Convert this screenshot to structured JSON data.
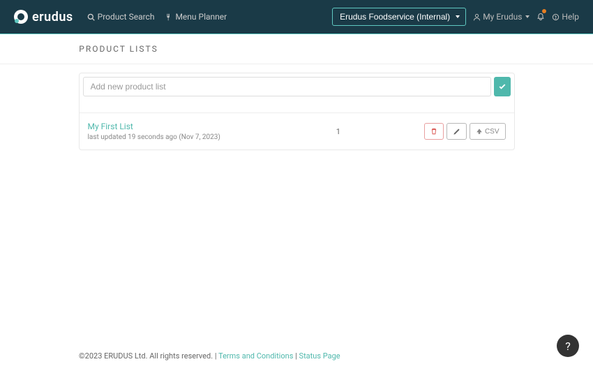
{
  "brand": "erudus",
  "nav": {
    "productSearch": "Product Search",
    "menuPlanner": "Menu Planner",
    "organization": "Erudus Foodservice (Internal)",
    "myErudus": "My Erudus",
    "help": "Help"
  },
  "page": {
    "title": "PRODUCT LISTS"
  },
  "input": {
    "placeholder": "Add new product list"
  },
  "lists": [
    {
      "name": "My First List",
      "meta": "last updated 19 seconds ago (Nov 7, 2023)",
      "count": "1"
    }
  ],
  "actions": {
    "csv": "CSV"
  },
  "footer": {
    "copyright": "©2023 ERUDUS Ltd. All rights reserved.",
    "sep1": " | ",
    "terms": "Terms and Conditions",
    "sep2": " | ",
    "status": "Status Page"
  },
  "fab": "?"
}
